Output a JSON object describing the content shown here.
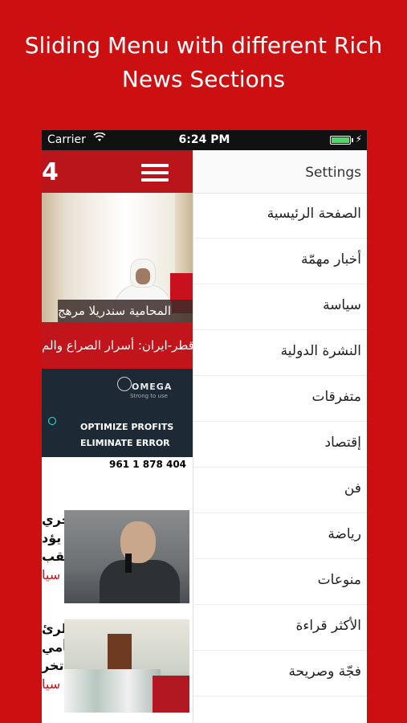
{
  "promo": {
    "line1": "Sliding Menu with different Rich",
    "line2": "News Sections"
  },
  "status_bar": {
    "carrier": "Carrier",
    "time": "6:24 PM"
  },
  "content": {
    "logo_fragment": "4",
    "hero_caption_1": "المحامية سندريلا مرهج",
    "hero_caption_2": "قطر-ايران: أسرار الصراع والم",
    "ad": {
      "brand": "OMEGA",
      "tagline": "Strong to use",
      "line1": "OPTIMIZE PROFITS",
      "line2": "ELIMINATE ERROR",
      "phone": "961 1 878 404"
    },
    "news": [
      {
        "lines": [
          "خري",
          "يؤد",
          "نقب"
        ],
        "meta": "سيا"
      },
      {
        "lines": [
          "الرئ",
          "تأمي",
          "تخر"
        ],
        "meta": "سيا"
      }
    ]
  },
  "menu": {
    "settings_label": "Settings",
    "items": [
      "الصفحة الرئيسية",
      "أخبار مهمّة",
      "سياسة",
      "النشرة الدولية",
      "متفرقات",
      "إقتصاد",
      "فن",
      "رياضة",
      "منوعات",
      "الأكثر قراءة",
      "فجّة وصريحة"
    ]
  },
  "colors": {
    "background_red": "#cc1011",
    "header_red": "#b9151a",
    "battery_green": "#4cd964"
  }
}
